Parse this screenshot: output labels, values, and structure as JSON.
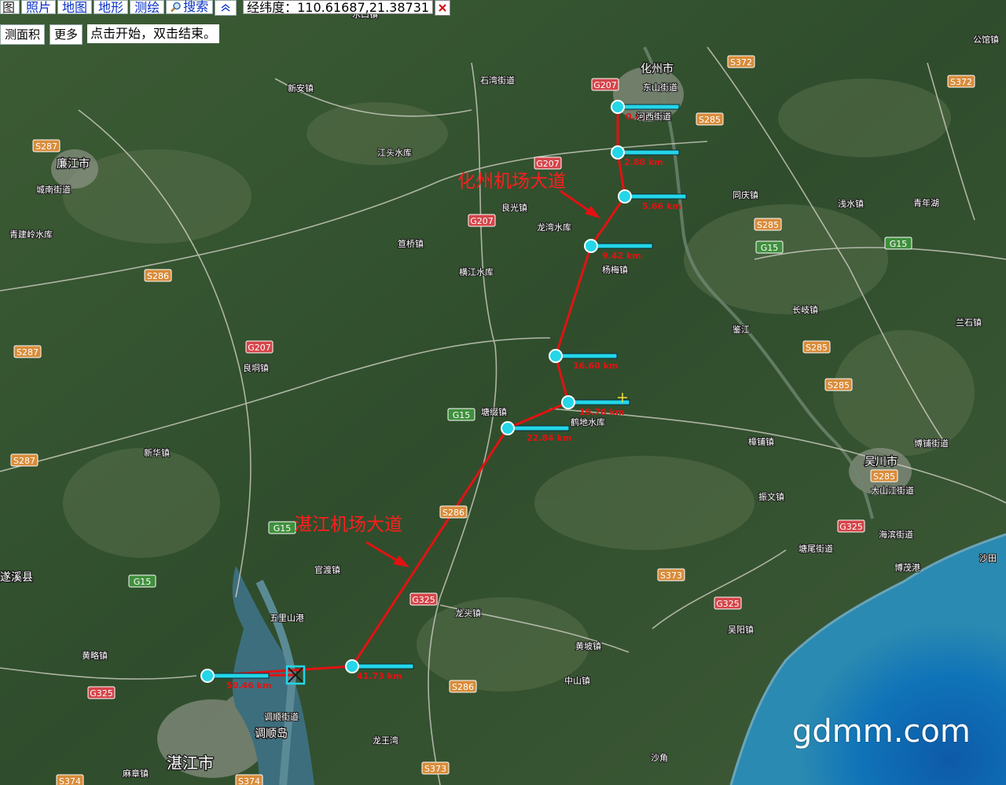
{
  "toolbar": {
    "tabs": [
      "图",
      "照片",
      "地图",
      "地形",
      "测绘"
    ],
    "search_label": "搜索",
    "coord_label": "经纬度：",
    "coord_value": "110.61687,21.38731",
    "area_button": "测面积",
    "more_button": "更多",
    "hint": "点击开始，双击结束。"
  },
  "icons": {
    "search": "magnifier-icon",
    "collapse": "chevron-up-icon",
    "close": "close-x-icon",
    "end_marker": "cross-box-icon"
  },
  "route": {
    "color": "#e21212",
    "vertex_color": "#23d6e8",
    "bar_color": "#23d6e8",
    "distances": [
      "0.00",
      "2.88 km",
      "5.66 km",
      "9.42 km",
      "16.60 km",
      "19.70 km",
      "22.84 km",
      "41.73 km",
      "50.46 km"
    ]
  },
  "annotations": {
    "huazhou_airport_road": "化州机场大道",
    "zhanjiang_airport_road": "湛江机场大道"
  },
  "towns": [
    "化州市",
    "东山街道",
    "河西街道",
    "石湾街道",
    "水口镇",
    "新安镇",
    "江头水库",
    "廉江市",
    "城南街道",
    "良光镇",
    "龙湾水库",
    "青建岭水库",
    "笪桥镇",
    "杨梅镇",
    "横江水库",
    "良垌镇",
    "塘缀镇",
    "鹤地水库",
    "新华镇",
    "同庆镇",
    "浅水镇",
    "青年湖",
    "长岐镇",
    "兰石镇",
    "吴川市",
    "大山江街道",
    "博铺街道",
    "振文镇",
    "塘尾街道",
    "海滨街道",
    "博茂港",
    "黄坡镇",
    "吴阳镇",
    "官渡镇",
    "五里山港",
    "龙头镇",
    "黄略镇",
    "调顺街道",
    "调顺岛",
    "湛江市",
    "麻章镇",
    "龙王湾",
    "中山镇",
    "遂溪县",
    "樟铺镇",
    "公馆镇",
    "沙田",
    "鉴江",
    "沙角"
  ],
  "roads": [
    "S372",
    "S372",
    "G207",
    "S285",
    "S287",
    "G207",
    "G207",
    "S286",
    "S287",
    "G207",
    "G15",
    "S285",
    "G15",
    "S285",
    "S285",
    "S287",
    "G15",
    "S286",
    "G15",
    "G325",
    "S285",
    "G325",
    "S373",
    "G325",
    "G325",
    "S286",
    "S373",
    "S374",
    "S374",
    "G15"
  ],
  "watermark": "gdmm.com"
}
